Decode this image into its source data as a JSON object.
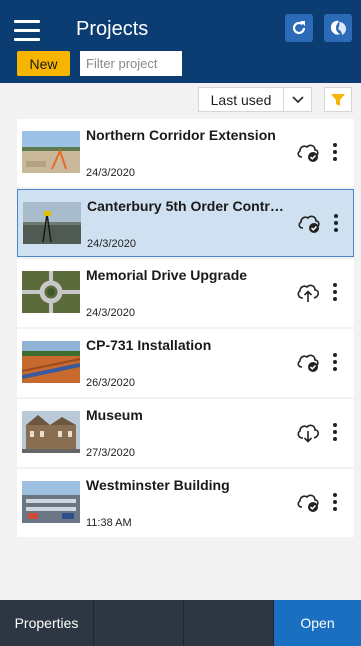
{
  "header": {
    "title": "Projects",
    "new_label": "New",
    "filter_placeholder": "Filter project"
  },
  "sort": {
    "selected": "Last used"
  },
  "projects": [
    {
      "name": "Northern Corridor Extension",
      "date": "24/3/2020",
      "cloud_status": "synced",
      "selected": false
    },
    {
      "name": "Canterbury 5th Order Control ...",
      "date": "24/3/2020",
      "cloud_status": "synced",
      "selected": true
    },
    {
      "name": "Memorial Drive Upgrade",
      "date": "24/3/2020",
      "cloud_status": "upload",
      "selected": false
    },
    {
      "name": "CP-731 Installation",
      "date": "26/3/2020",
      "cloud_status": "synced",
      "selected": false
    },
    {
      "name": "Museum",
      "date": "27/3/2020",
      "cloud_status": "download",
      "selected": false
    },
    {
      "name": "Westminster Building",
      "date": "11:38 AM",
      "cloud_status": "synced",
      "selected": false
    }
  ],
  "footer": {
    "properties_label": "Properties",
    "open_label": "Open"
  },
  "colors": {
    "header_bg": "#0b3d73",
    "accent_yellow": "#f7b500",
    "selected_row": "#cfe0f1",
    "open_button": "#1a6fc0",
    "footer_bg": "#2d3744"
  },
  "icons": [
    "hamburger-menu-icon",
    "refresh-icon",
    "sync-icon",
    "chevron-down-icon",
    "filter-icon",
    "cloud-synced-icon",
    "cloud-upload-icon",
    "cloud-download-icon",
    "more-vertical-icon"
  ]
}
